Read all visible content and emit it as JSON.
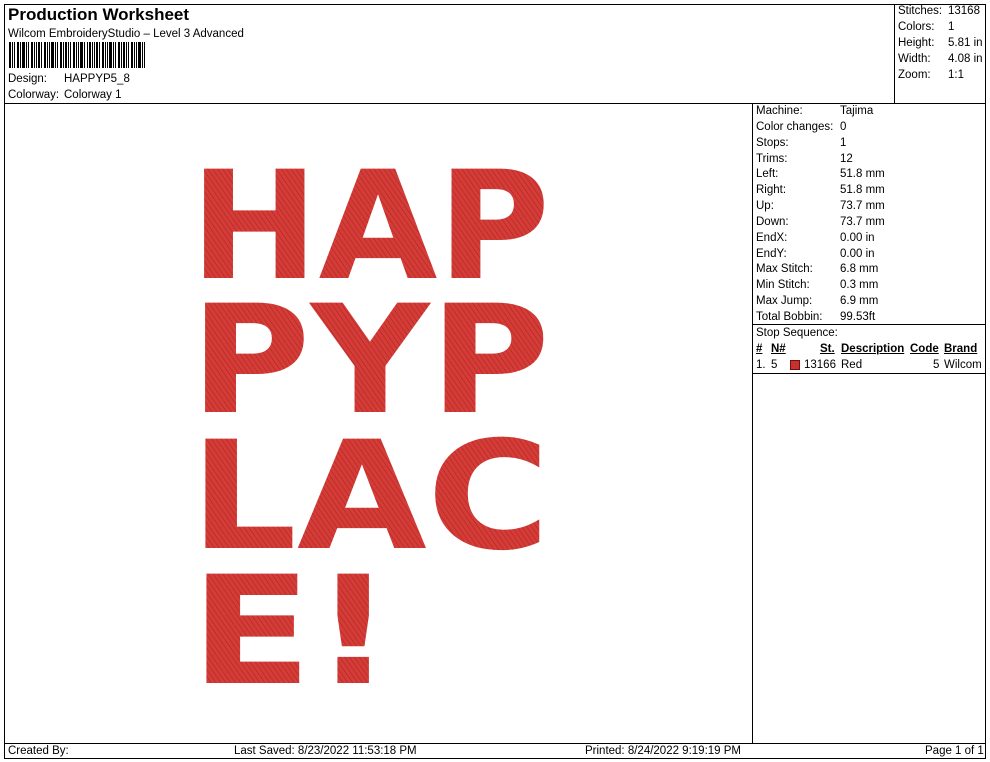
{
  "header": {
    "title": "Production Worksheet",
    "subtitle": "Wilcom EmbroideryStudio – Level 3 Advanced",
    "design_label": "Design:",
    "design_value": "HAPPYP5_8",
    "colorway_label": "Colorway:",
    "colorway_value": "Colorway 1"
  },
  "summary": [
    {
      "label": "Stitches:",
      "value": "13168"
    },
    {
      "label": "Colors:",
      "value": "1"
    },
    {
      "label": "Height:",
      "value": "5.81 in"
    },
    {
      "label": "Width:",
      "value": "4.08 in"
    },
    {
      "label": "Zoom:",
      "value": "1:1"
    }
  ],
  "specs": [
    {
      "label": "Machine:",
      "value": "Tajima"
    },
    {
      "label": "Color changes:",
      "value": "0"
    },
    {
      "label": "Stops:",
      "value": "1"
    },
    {
      "label": "Trims:",
      "value": "12"
    },
    {
      "label": "Left:",
      "value": "51.8 mm"
    },
    {
      "label": "Right:",
      "value": "51.8 mm"
    },
    {
      "label": "Up:",
      "value": "73.7 mm"
    },
    {
      "label": "Down:",
      "value": "73.7 mm"
    },
    {
      "label": "EndX:",
      "value": "0.00 in"
    },
    {
      "label": "EndY:",
      "value": "0.00 in"
    },
    {
      "label": "Max Stitch:",
      "value": "6.8 mm"
    },
    {
      "label": "Min Stitch:",
      "value": "0.3 mm"
    },
    {
      "label": "Max Jump:",
      "value": "6.9 mm"
    },
    {
      "label": "Total Bobbin:",
      "value": "99.53ft"
    }
  ],
  "stop_sequence": {
    "title": "Stop Sequence:",
    "headers": {
      "num": "#",
      "needle": "N#",
      "stitches": "St.",
      "description": "Description",
      "code": "Code",
      "brand": "Brand"
    },
    "rows": [
      {
        "num": "1.",
        "needle": "5",
        "color": "#c8312e",
        "stitches": "13166",
        "description": "Red",
        "code": "5",
        "brand": "Wilcom"
      }
    ]
  },
  "design_preview": {
    "lines": [
      "HAP",
      "PYP",
      "LAC",
      "E!"
    ],
    "thread_color": "#c8312e"
  },
  "footer": {
    "created_by": "Created By:",
    "last_saved": "Last Saved: 8/23/2022 11:53:18 PM",
    "printed": "Printed: 8/24/2022 9:19:19 PM",
    "page": "Page 1 of 1"
  }
}
